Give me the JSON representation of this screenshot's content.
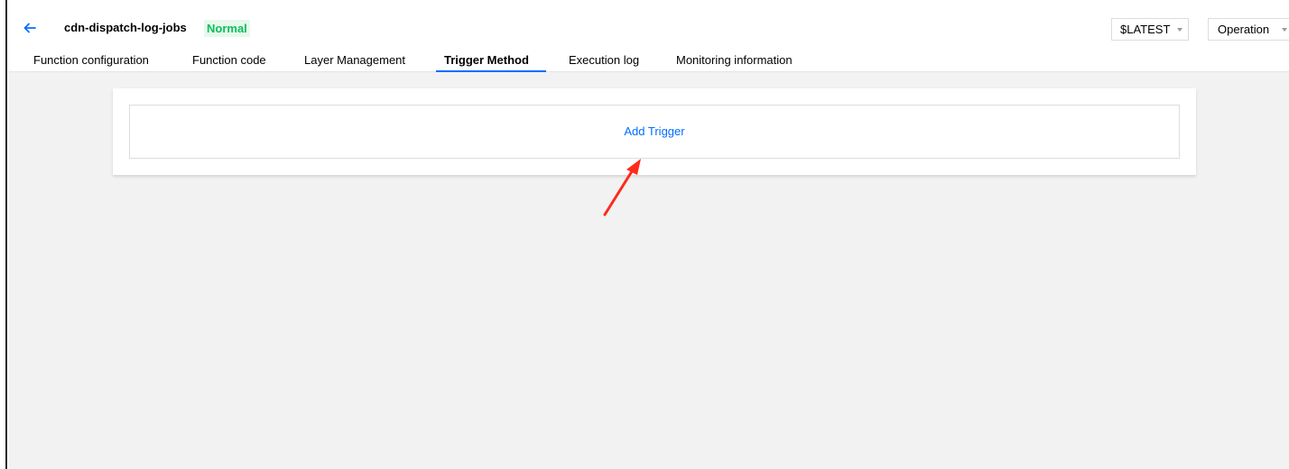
{
  "header": {
    "function_name": "cdn-dispatch-log-jobs",
    "status": "Normal",
    "version_select": {
      "value": "$LATEST"
    },
    "operation_select": {
      "label": "Operation"
    }
  },
  "tabs": [
    {
      "label": "Function configuration",
      "active": false
    },
    {
      "label": "Function code",
      "active": false
    },
    {
      "label": "Layer Management",
      "active": false
    },
    {
      "label": "Trigger Method",
      "active": true
    },
    {
      "label": "Execution log",
      "active": false
    },
    {
      "label": "Monitoring information",
      "active": false
    }
  ],
  "main": {
    "add_trigger_label": "Add Trigger"
  },
  "colors": {
    "accent": "#006eff",
    "status_text": "#0abf5b",
    "status_bg": "#e7f8ec",
    "annotation_arrow": "#ff2a1a"
  },
  "icons": {
    "back": "arrow-left-icon",
    "dropdown": "caret-down-icon",
    "annotation": "red-arrow-annotation"
  }
}
